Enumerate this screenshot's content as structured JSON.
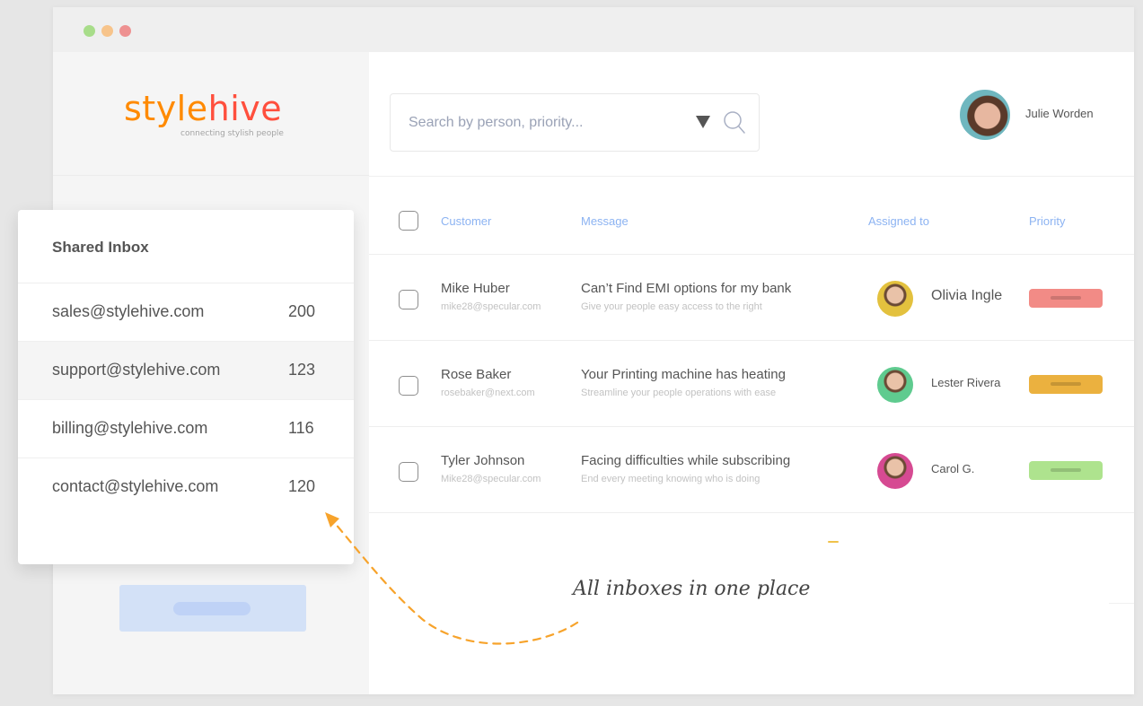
{
  "window": {
    "controls": [
      "close",
      "minimize",
      "maximize"
    ]
  },
  "brand": {
    "name_part1": "style",
    "name_part2": "hive",
    "tagline": "connecting stylish people",
    "colors": {
      "primary": "#ff8a00",
      "secondary": "#ff4f3d"
    }
  },
  "search": {
    "placeholder": "Search by person, priority...",
    "value": "",
    "filter_icon": "caret-down-icon",
    "search_icon": "search-icon"
  },
  "user": {
    "name": "Julie Worden"
  },
  "table": {
    "headers": {
      "customer": "Customer",
      "message": "Message",
      "assigned_to": "Assigned to",
      "priority": "Priority"
    },
    "rows": [
      {
        "customer_name": "Mike Huber",
        "customer_email": "mike28@specular.com",
        "message_title": "Can’t Find EMI options for my bank",
        "message_preview": "Give your people easy access to the right",
        "assignee": "Olivia Ingle",
        "priority": "high",
        "priority_color": "#f28b86",
        "avatar_color": "#e3c13e"
      },
      {
        "customer_name": "Rose Baker",
        "customer_email": "rosebaker@next.com",
        "message_title": "Your Printing machine has heating",
        "message_preview": "Streamline your people operations with ease",
        "assignee": "Lester Rivera",
        "priority": "medium",
        "priority_color": "#ebb13f",
        "avatar_color": "#5fcb8f"
      },
      {
        "customer_name": "Tyler Johnson",
        "customer_email": "Mike28@specular.com",
        "message_title": "Facing difficulties while subscribing",
        "message_preview": "End every meeting knowing who is doing",
        "assignee": "Carol G.",
        "priority": "low",
        "priority_color": "#aee38e",
        "avatar_color": "#d64a92"
      }
    ]
  },
  "shared_inbox": {
    "title": "Shared Inbox",
    "items": [
      {
        "email": "sales@stylehive.com",
        "count": "200"
      },
      {
        "email": "support@stylehive.com",
        "count": "123",
        "active": true
      },
      {
        "email": "billing@stylehive.com",
        "count": "116"
      },
      {
        "email": "contact@stylehive.com",
        "count": "120"
      }
    ]
  },
  "annotation": {
    "text": "All inboxes in one place",
    "arrow_color": "#f7a32b"
  }
}
